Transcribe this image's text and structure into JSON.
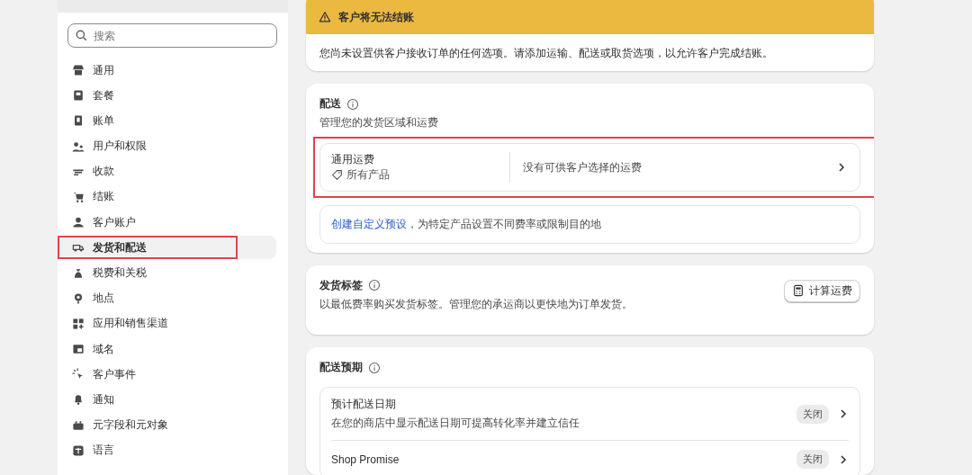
{
  "sidebar": {
    "search": {
      "placeholder": "搜索"
    },
    "items": [
      {
        "label": "通用",
        "selected": false,
        "highlighted": false
      },
      {
        "label": "套餐",
        "selected": false,
        "highlighted": false
      },
      {
        "label": "账单",
        "selected": false,
        "highlighted": false
      },
      {
        "label": "用户和权限",
        "selected": false,
        "highlighted": false
      },
      {
        "label": "收款",
        "selected": false,
        "highlighted": false
      },
      {
        "label": "结账",
        "selected": false,
        "highlighted": false
      },
      {
        "label": "客户账户",
        "selected": false,
        "highlighted": false
      },
      {
        "label": "发货和配送",
        "selected": true,
        "highlighted": true
      },
      {
        "label": "税费和关税",
        "selected": false,
        "highlighted": false
      },
      {
        "label": "地点",
        "selected": false,
        "highlighted": false
      },
      {
        "label": "应用和销售渠道",
        "selected": false,
        "highlighted": false
      },
      {
        "label": "域名",
        "selected": false,
        "highlighted": false
      },
      {
        "label": "客户事件",
        "selected": false,
        "highlighted": false
      },
      {
        "label": "通知",
        "selected": false,
        "highlighted": false
      },
      {
        "label": "元字段和元对象",
        "selected": false,
        "highlighted": false
      },
      {
        "label": "语言",
        "selected": false,
        "highlighted": false
      }
    ]
  },
  "alert": {
    "title": "客户将无法结账",
    "message": "您尚未设置供客户接收订单的任何选项。请添加运输、配送或取货选项，以允许客户完成结账。"
  },
  "shipping": {
    "title": "配送",
    "subtitle": "管理您的发货区域和运费",
    "rate": {
      "name": "通用运费",
      "products": "所有产品",
      "status": "没有可供客户选择的运费",
      "highlighted": true
    },
    "custom": {
      "link": "创建自定义预设",
      "text": "，为特定产品设置不同费率或限制目的地"
    }
  },
  "labels": {
    "title": "发货标签",
    "description": "以最低费率购买发货标签。管理您的承运商以更快地为订单发货。",
    "button": "计算运费"
  },
  "delivery": {
    "title": "配送预期",
    "rows": [
      {
        "title": "预计配送日期",
        "description": "在您的商店中显示配送日期可提高转化率并建立信任",
        "status": "关闭"
      },
      {
        "title": "Shop Promise",
        "status": "关闭"
      }
    ]
  }
}
